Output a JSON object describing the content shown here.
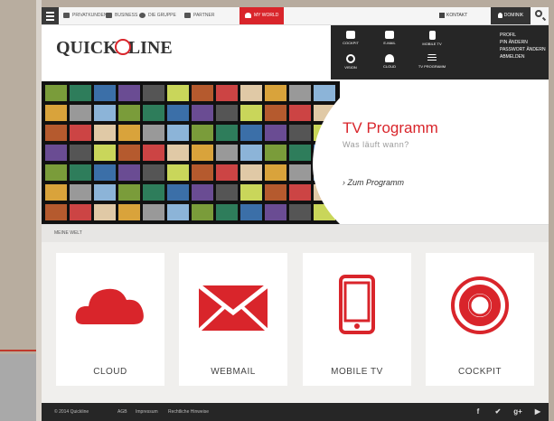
{
  "nav": {
    "items": [
      {
        "label": "Privatkunden",
        "icon": "person-icon"
      },
      {
        "label": "Business",
        "icon": "group-icon"
      },
      {
        "label": "Die Gruppe",
        "icon": "globe-icon"
      },
      {
        "label": "Partner",
        "icon": "partner-icon"
      }
    ],
    "active": {
      "label": "My World",
      "icon": "user-icon"
    },
    "contact": "Kontakt",
    "user": "Dominik"
  },
  "brand": {
    "logo_pre": "QUICK",
    "logo_post": "LINE"
  },
  "dropdown": {
    "tiles": [
      {
        "label": "Cockpit",
        "icon": "cockpit-icon"
      },
      {
        "label": "E-Mail",
        "icon": "mail-icon"
      },
      {
        "label": "Mobile TV",
        "icon": "tablet-icon"
      },
      {
        "label": "Vision",
        "icon": "eye-icon"
      },
      {
        "label": "Cloud",
        "icon": "cloud-icon"
      },
      {
        "label": "TV Programm",
        "icon": "list-icon"
      }
    ],
    "menu": [
      "Profil",
      "PIN ändern",
      "Passwort ändern",
      "Abmelden"
    ]
  },
  "hero": {
    "title": "TV Programm",
    "subtitle": "Was läuft wann?",
    "link": "› Zum Programm"
  },
  "section": {
    "label": "Meine Welt"
  },
  "tiles": [
    {
      "label": "CLOUD",
      "icon": "cloud-icon"
    },
    {
      "label": "WEBMAIL",
      "icon": "mail-icon"
    },
    {
      "label": "MOBILE TV",
      "icon": "tablet-icon"
    },
    {
      "label": "COCKPIT",
      "icon": "lifebuoy-icon"
    }
  ],
  "footer": {
    "copyright": "© 2014 Quickline",
    "links": [
      "AGB",
      "Impressum",
      "Rechtliche Hinweise"
    ],
    "social": [
      "facebook-icon",
      "twitter-icon",
      "googleplus-icon",
      "youtube-icon"
    ]
  },
  "colors": {
    "accent": "#d9252b",
    "dark": "#262626",
    "light": "#f0efed"
  }
}
